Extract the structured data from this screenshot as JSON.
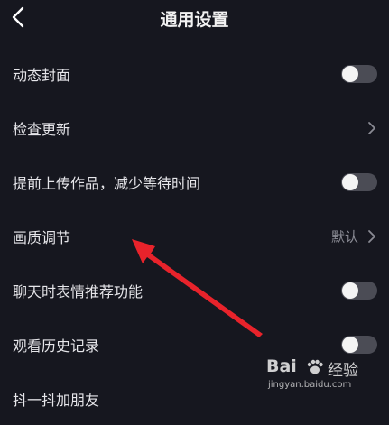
{
  "header": {
    "title": "通用设置",
    "back_icon": "chevron-left-icon"
  },
  "settings": [
    {
      "label": "动态封面",
      "control": "toggle",
      "on": false
    },
    {
      "label": "检查更新",
      "control": "chevron"
    },
    {
      "label": "提前上传作品，减少等待时间",
      "control": "toggle",
      "on": false
    },
    {
      "label": "画质调节",
      "control": "chevron",
      "value": "默认"
    },
    {
      "label": "聊天时表情推荐功能",
      "control": "toggle",
      "on": false
    },
    {
      "label": "观看历史记录",
      "control": "toggle",
      "on": false
    },
    {
      "label": "抖一抖加朋友",
      "control": "partial"
    }
  ],
  "annotation": {
    "type": "red-arrow",
    "color": "#e8232b",
    "points_to": "画质调节"
  },
  "watermark": {
    "logo_text": "Bai",
    "brand_text": "经验",
    "url": "jingyan.baidu.com"
  },
  "colors": {
    "background": "#16171f",
    "toggle_track": "#4b4c55",
    "toggle_knob": "#f4f4f4",
    "secondary_text": "#8a8b94"
  }
}
